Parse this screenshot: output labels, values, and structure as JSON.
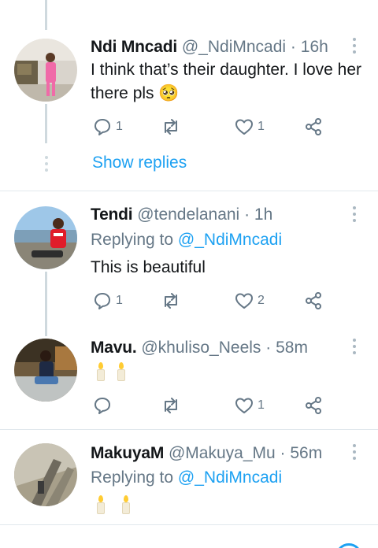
{
  "tweets": [
    {
      "name": "Ndi Mncadi",
      "handle": "@_NdiMncadi",
      "sep": "·",
      "time": "16h",
      "text": "I think that’s their daughter. I love her there pls 🥺",
      "replies": "1",
      "retweets": "",
      "likes": "1"
    },
    {
      "name": "Tendi",
      "handle": "@tendelanani",
      "sep": "·",
      "time": "1h",
      "replying_prefix": "Replying to",
      "replying_to": "@_NdiMncadi",
      "text": "This is beautiful",
      "replies": "1",
      "retweets": "",
      "likes": "2"
    },
    {
      "name": "Mavu.",
      "handle": "@khuliso_Neels",
      "sep": "·",
      "time": "58m",
      "text_emoji": "candle-emoji x2",
      "replies": "",
      "retweets": "",
      "likes": "1"
    },
    {
      "name": "MakuyaM",
      "handle": "@Makuya_Mu",
      "sep": "·",
      "time": "56m",
      "replying_prefix": "Replying to",
      "replying_to": "@_NdiMncadi",
      "text_emoji": "candle-emoji x2"
    }
  ],
  "show_replies_label": "Show replies",
  "colors": {
    "accent": "#1da1f2",
    "secondary_text": "#657786",
    "icon": "#657786",
    "thread_line": "#cfd9de",
    "divider": "#e1e8ed"
  },
  "icons": [
    "reply-icon",
    "retweet-icon",
    "like-icon",
    "share-icon",
    "more-icon"
  ]
}
